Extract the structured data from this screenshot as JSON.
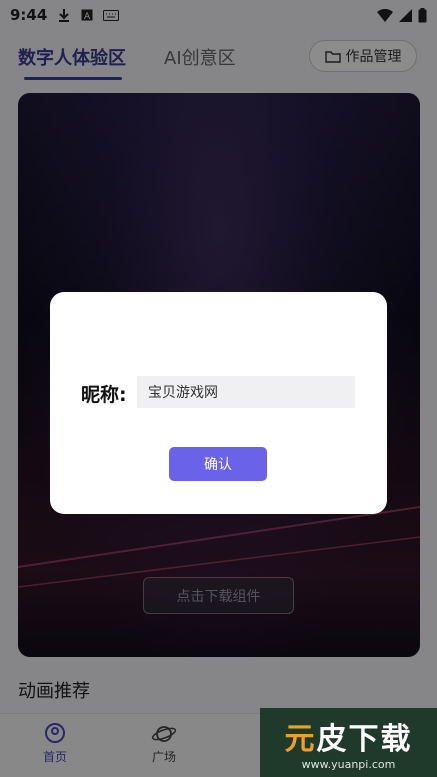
{
  "status_bar": {
    "time": "9:44"
  },
  "tabs": {
    "active_label": "数字人体验区",
    "inactive_label": "AI创意区"
  },
  "works_button": {
    "label": "作品管理"
  },
  "hero": {
    "download_label": "点击下载组件"
  },
  "section": {
    "title": "动画推荐"
  },
  "bottom_nav": {
    "home_label": "首页",
    "square_label": "广场"
  },
  "dialog": {
    "nickname_label": "昵称:",
    "nickname_value": "宝贝游戏网",
    "confirm_label": "确认"
  },
  "watermark": {
    "logo_main": "元",
    "logo_rest": "皮下载",
    "url": "www.yuanpi.com"
  },
  "colors": {
    "accent": "#6a62e8",
    "active_tab": "#3b3b8f"
  }
}
